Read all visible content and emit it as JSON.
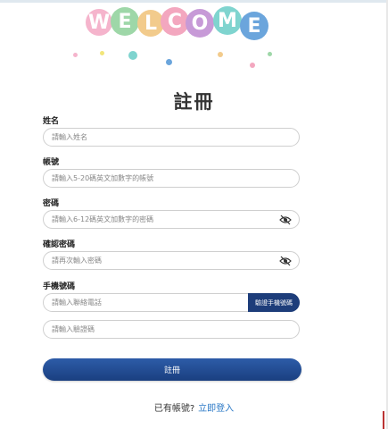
{
  "welcome": {
    "letters": [
      "W",
      "E",
      "L",
      "C",
      "O",
      "M",
      "E"
    ],
    "colors": [
      "#f5b4cc",
      "#9ed7a8",
      "#f2cb8c",
      "#f3a7bf",
      "#c79ad7",
      "#7fd4cf",
      "#6ba5dc"
    ]
  },
  "form": {
    "title": "註冊",
    "name": {
      "label": "姓名",
      "placeholder": "請輸入姓名"
    },
    "account": {
      "label": "帳號",
      "placeholder": "請輸入5-20碼英文加數字的帳號"
    },
    "password": {
      "label": "密碼",
      "placeholder": "請輸入6-12碼英文加數字的密碼"
    },
    "confirm": {
      "label": "確認密碼",
      "placeholder": "請再次輸入密碼"
    },
    "phone": {
      "label": "手機號碼",
      "placeholder": "請輸入聯絡電話",
      "verify_button": "驗證手機號碼"
    },
    "code": {
      "placeholder": "請輸入驗證碼"
    },
    "submit_label": "註冊"
  },
  "footer": {
    "prompt": "已有帳號?",
    "login_link": "立即登入"
  },
  "icons": {
    "password_toggle": "eye-slash-icon",
    "confirm_toggle": "eye-slash-icon"
  },
  "colors": {
    "primary": "#1d3d7a",
    "link": "#2a78c6"
  }
}
